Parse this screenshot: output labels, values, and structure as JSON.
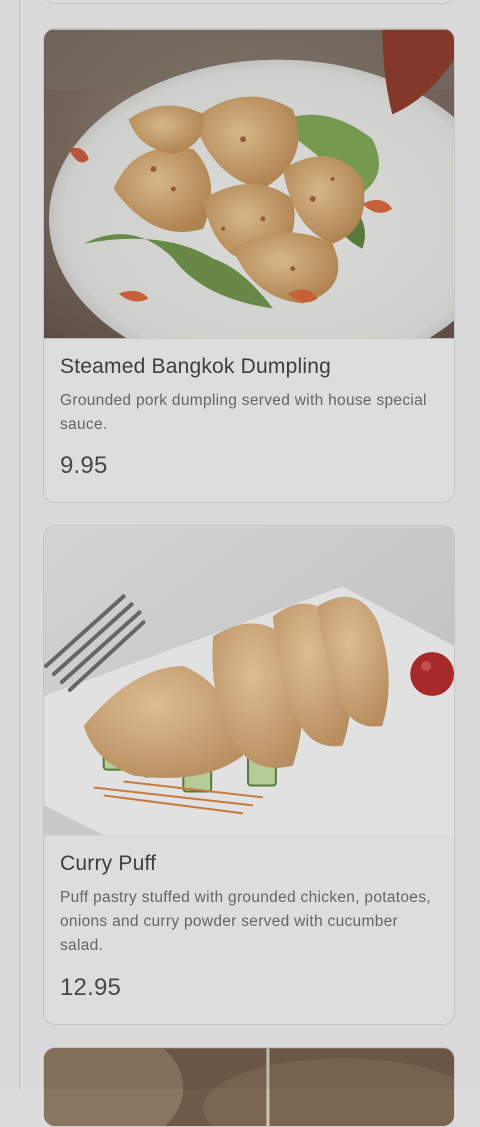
{
  "menu_items": [
    {
      "name": "Steamed Bangkok Dumpling",
      "description": "Grounded pork dumpling served with house special sauce.",
      "price": "9.95"
    },
    {
      "name": "Curry Puff",
      "description": "Puff pastry stuffed with grounded chicken, potatoes, onions and curry powder served with cucumber salad.",
      "price": "12.95"
    }
  ]
}
